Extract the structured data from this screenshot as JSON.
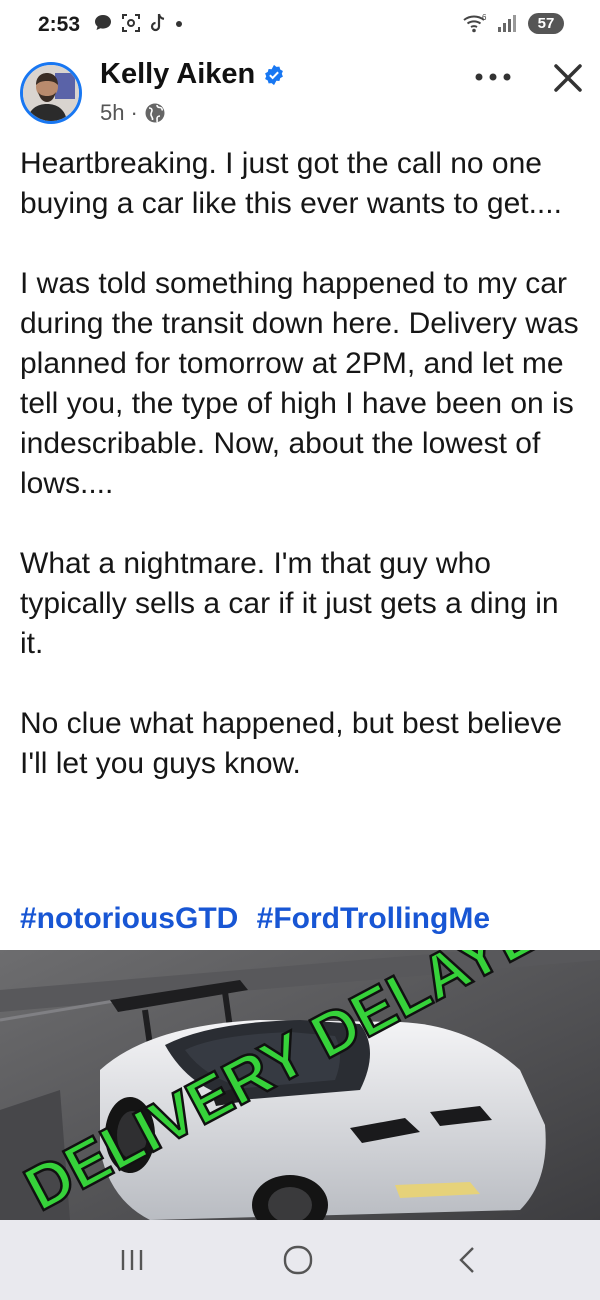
{
  "status_bar": {
    "time": "2:53",
    "battery": "57"
  },
  "post": {
    "author": "Kelly Aiken",
    "time_ago": "5h",
    "separator": "·",
    "paragraphs": [
      "Heartbreaking. I just got the call no one buying a car like this ever wants to get....",
      "I was told something happened to my car during the transit down here. Delivery was planned for tomorrow at 2PM, and let me tell you, the type of high I have been on is indescribable. Now, about the lowest of lows....",
      "What a nightmare. I'm that guy who typically sells a car if it just gets a ding in it.",
      "No clue what happened, but best believe I'll let you guys know."
    ],
    "hashtags": [
      "#notoriousGTD",
      "#FordTrollingMe"
    ],
    "image_overlay_text": "DELIVERY DELAYED"
  },
  "icons": {
    "status_left": [
      "chat-icon",
      "screenshot-icon",
      "tiktok-icon",
      "dot-icon"
    ],
    "status_right": [
      "wifi-icon",
      "signal-icon"
    ],
    "header": [
      "verified-icon",
      "globe-icon",
      "more-icon",
      "close-icon"
    ],
    "nav": [
      "recents-icon",
      "home-icon",
      "back-icon"
    ]
  },
  "colors": {
    "link": "#1856d4",
    "verified": "#1877f2",
    "overlay_text": "#36d23a",
    "nav_bg": "#e9e9ee"
  }
}
